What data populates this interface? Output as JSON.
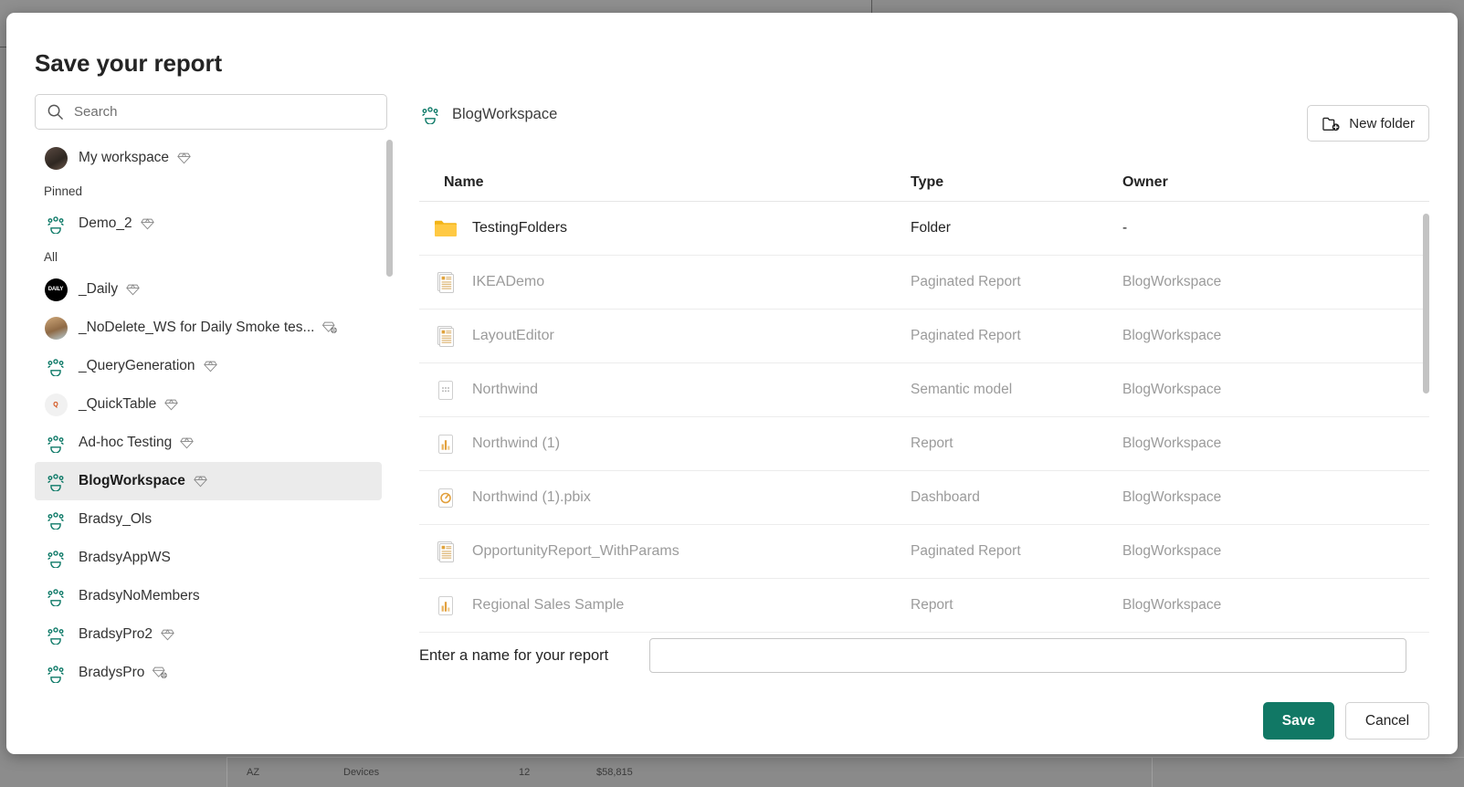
{
  "dialog": {
    "title": "Save your report"
  },
  "search": {
    "placeholder": "Search",
    "value": "",
    "icon": "search-icon"
  },
  "sidebar": {
    "my_workspace": {
      "label": "My workspace",
      "icon": "user-avatar",
      "badge": "premium-diamond-icon"
    },
    "sections": [
      {
        "heading": "Pinned"
      },
      {
        "heading": "All"
      }
    ],
    "pinned": [
      {
        "label": "Demo_2",
        "icon": "workspace-group-icon",
        "badge": "premium-diamond-icon"
      }
    ],
    "all": [
      {
        "label": "_Daily",
        "icon": "avatar-dark",
        "badge": "premium-diamond-icon",
        "selected": false
      },
      {
        "label": "_NoDelete_WS for Daily Smoke tes...",
        "icon": "avatar-dog",
        "badge": "premium-globe-diamond-icon",
        "selected": false
      },
      {
        "label": "_QueryGeneration",
        "icon": "workspace-group-icon",
        "badge": "premium-diamond-icon",
        "selected": false
      },
      {
        "label": "_QuickTable",
        "icon": "avatar-quick",
        "badge": "premium-diamond-icon",
        "selected": false
      },
      {
        "label": "Ad-hoc Testing",
        "icon": "workspace-group-icon",
        "badge": "premium-diamond-icon",
        "selected": false
      },
      {
        "label": "BlogWorkspace",
        "icon": "workspace-group-icon",
        "badge": "premium-diamond-icon",
        "selected": true
      },
      {
        "label": "Bradsy_Ols",
        "icon": "workspace-group-icon",
        "badge": "",
        "selected": false
      },
      {
        "label": "BradsyAppWS",
        "icon": "workspace-group-icon",
        "badge": "",
        "selected": false
      },
      {
        "label": "BradsyNoMembers",
        "icon": "workspace-group-icon",
        "badge": "",
        "selected": false
      },
      {
        "label": "BradsyPro2",
        "icon": "workspace-group-icon",
        "badge": "premium-diamond-icon",
        "selected": false
      },
      {
        "label": "BradysPro",
        "icon": "workspace-group-icon",
        "badge": "premium-globe-diamond-icon",
        "selected": false
      }
    ]
  },
  "content": {
    "breadcrumb": {
      "label": "BlogWorkspace",
      "icon": "workspace-group-icon"
    },
    "new_folder_button": {
      "label": "New folder",
      "icon": "new-folder-icon"
    },
    "columns": {
      "name": "Name",
      "type": "Type",
      "owner": "Owner"
    },
    "rows": [
      {
        "name": "TestingFolders",
        "type": "Folder",
        "owner": "-",
        "icon": "folder-icon",
        "enabled": true
      },
      {
        "name": "IKEADemo",
        "type": "Paginated Report",
        "owner": "BlogWorkspace",
        "icon": "paginated-report-icon",
        "enabled": false
      },
      {
        "name": "LayoutEditor",
        "type": "Paginated Report",
        "owner": "BlogWorkspace",
        "icon": "paginated-report-icon",
        "enabled": false
      },
      {
        "name": "Northwind",
        "type": "Semantic model",
        "owner": "BlogWorkspace",
        "icon": "semantic-model-icon",
        "enabled": false
      },
      {
        "name": "Northwind (1)",
        "type": "Report",
        "owner": "BlogWorkspace",
        "icon": "report-icon",
        "enabled": false
      },
      {
        "name": "Northwind (1).pbix",
        "type": "Dashboard",
        "owner": "BlogWorkspace",
        "icon": "dashboard-icon",
        "enabled": false
      },
      {
        "name": "OpportunityReport_WithParams",
        "type": "Paginated Report",
        "owner": "BlogWorkspace",
        "icon": "paginated-report-icon",
        "enabled": false
      },
      {
        "name": "Regional Sales Sample",
        "type": "Report",
        "owner": "BlogWorkspace",
        "icon": "report-icon",
        "enabled": false
      }
    ]
  },
  "footer": {
    "name_label": "Enter a name for your report",
    "name_value": "",
    "name_placeholder": "",
    "save_label": "Save",
    "cancel_label": "Cancel"
  },
  "background": {
    "table_row": {
      "state": "AZ",
      "category": "Devices",
      "count": "12",
      "amount": "$58,815"
    }
  },
  "colors": {
    "accent_teal": "#117865",
    "workspace_icon_teal": "#0e7a68",
    "folder_yellow": "#f5c23b",
    "disabled_text": "#9b9b9b",
    "selected_row_bg": "#ebebeb"
  }
}
